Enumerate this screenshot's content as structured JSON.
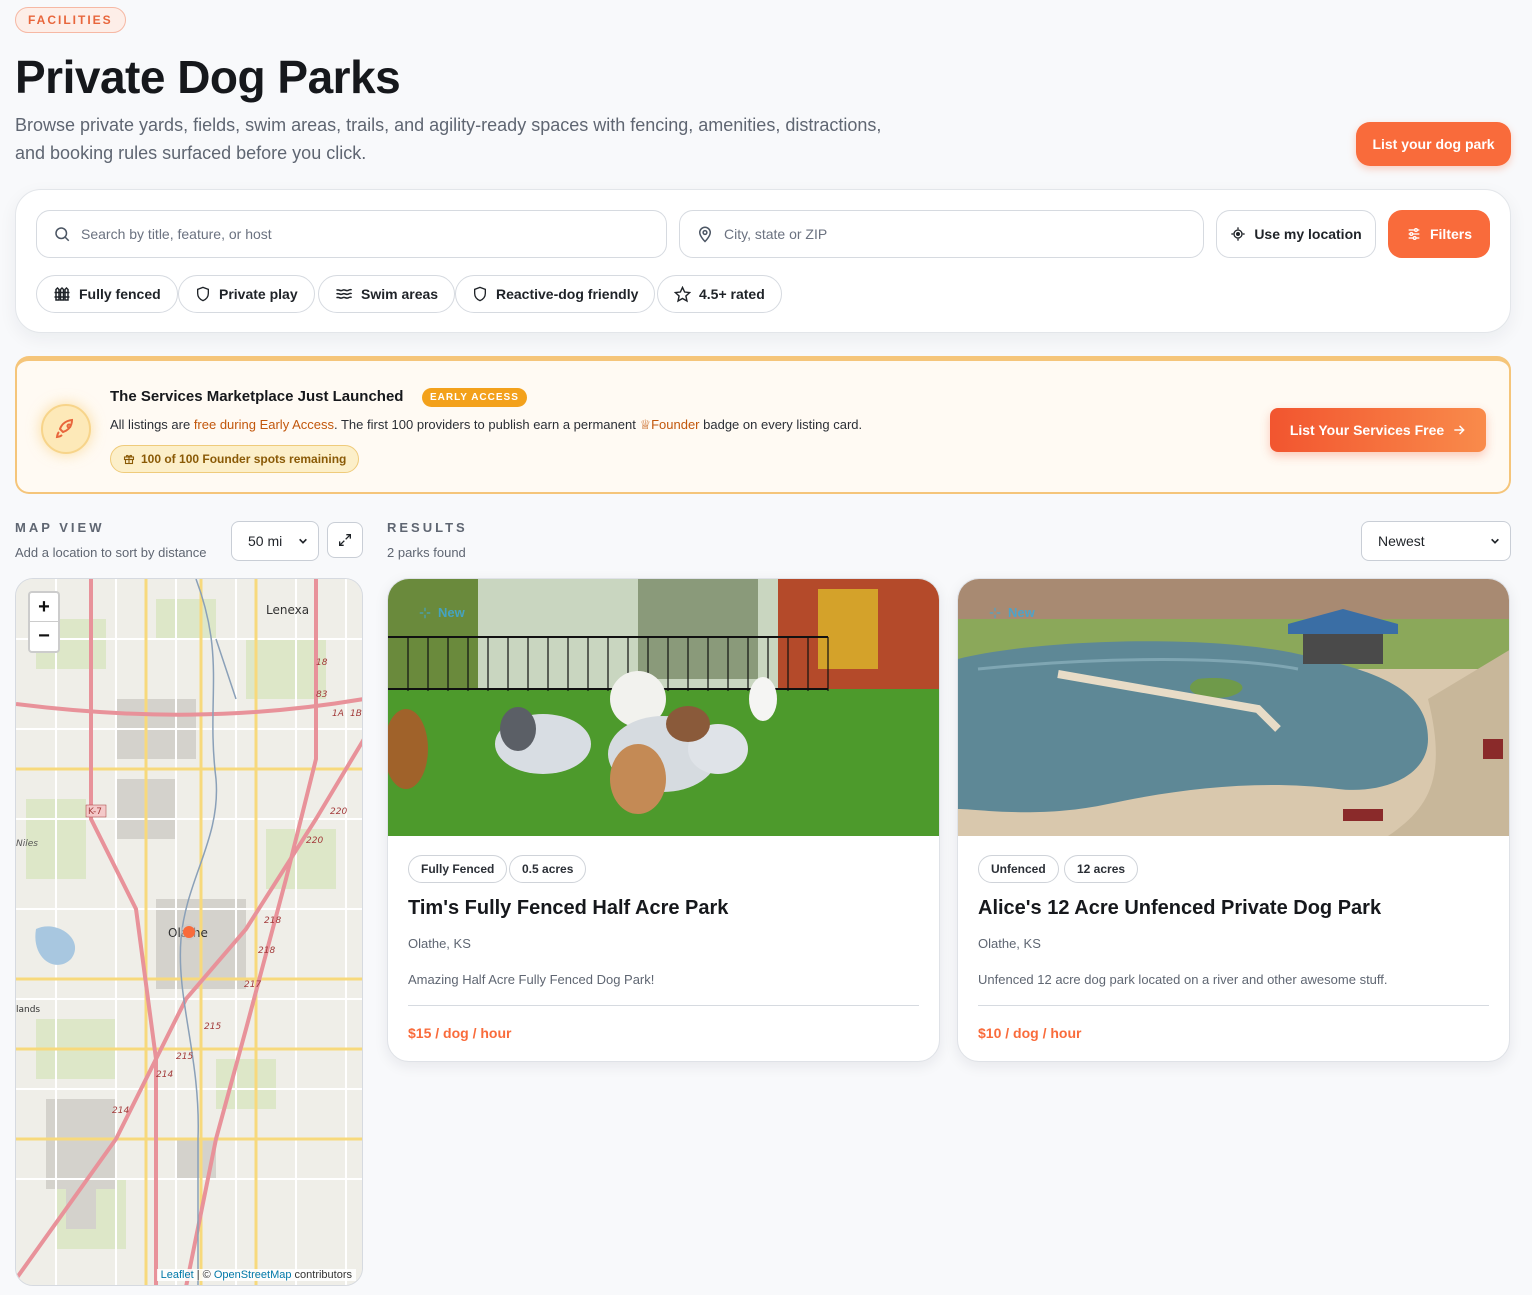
{
  "header": {
    "eyebrow": "FACILITIES",
    "title": "Private Dog Parks",
    "subtitle": "Browse private yards, fields, swim areas, trails, and agility-ready spaces with fencing, amenities, distractions, and booking rules surfaced before you click.",
    "cta_label": "List your dog park"
  },
  "search": {
    "keyword_placeholder": "Search by title, feature, or host",
    "location_placeholder": "City, state or ZIP",
    "use_location_label": "Use my location",
    "filters_label": "Filters",
    "chips": [
      {
        "label": "Fully fenced",
        "icon": "fence-icon"
      },
      {
        "label": "Private play",
        "icon": "shield-icon"
      },
      {
        "label": "Swim areas",
        "icon": "waves-icon"
      },
      {
        "label": "Reactive-dog friendly",
        "icon": "shield-icon"
      },
      {
        "label": "4.5+ rated",
        "icon": "star-icon"
      }
    ]
  },
  "promo": {
    "title": "The Services Marketplace Just Launched",
    "badge": "EARLY ACCESS",
    "text_1": "All listings are ",
    "text_hl": "free during Early Access",
    "text_2": ". The first 100 providers to publish earn a permanent ",
    "founder": "♕Founder",
    "text_3": " badge on every listing card.",
    "spots": "100 of 100 Founder spots remaining",
    "cta": "List Your Services Free"
  },
  "map": {
    "label": "MAP VIEW",
    "sub": "Add a location to sort by distance",
    "radius": "50 mi",
    "attribution_leaflet": "Leaflet",
    "attribution_sep": " | © ",
    "attribution_osm": "OpenStreetMap",
    "attribution_end": " contributors",
    "place_labels": [
      "Lenexa",
      "Olathe",
      "Niles",
      "lands"
    ],
    "route_labels": [
      "K-7",
      "220",
      "220",
      "218",
      "218",
      "217",
      "215",
      "215",
      "214",
      "214",
      "18",
      "83",
      "1A",
      "1B"
    ]
  },
  "results": {
    "label": "RESULTS",
    "count": "2 parks found",
    "sort": "Newest",
    "listings": [
      {
        "badge": "New",
        "tags": [
          "Fully Fenced",
          "0.5 acres"
        ],
        "title": "Tim's Fully Fenced Half Acre Park",
        "location": "Olathe, KS",
        "description": "Amazing Half Acre Fully Fenced Dog Park!",
        "price": "$15 / dog / hour"
      },
      {
        "badge": "New",
        "tags": [
          "Unfenced",
          "12 acres"
        ],
        "title": "Alice's 12 Acre Unfenced Private Dog Park",
        "location": "Olathe, KS",
        "description": "Unfenced 12 acre dog park located on a river and other awesome stuff.",
        "price": "$10 / dog / hour"
      }
    ]
  },
  "colors": {
    "accent": "#f96b3b",
    "promo_border": "#f5c57a",
    "price": "#f96b3b"
  }
}
